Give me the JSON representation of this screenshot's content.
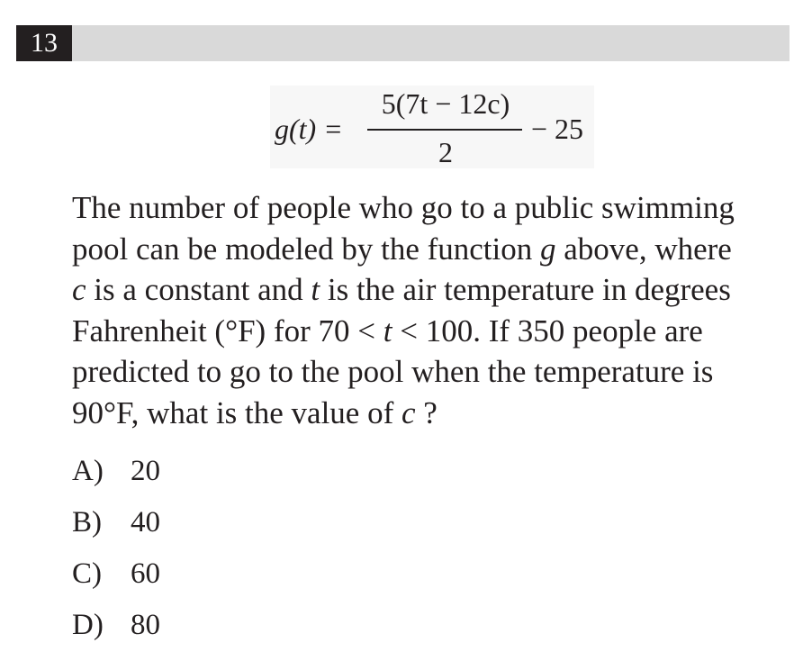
{
  "question_number": "13",
  "formula": {
    "lhs": "g(t) =",
    "numerator": "5(7t − 12c)",
    "denominator": "2",
    "rhs": "− 25"
  },
  "question_text": {
    "line1": "The number of people who go to a public swimming",
    "line2_a": "pool can be modeled by the function ",
    "line2_var": "g",
    "line2_b": " above, where",
    "line3_var_c": "c",
    "line3_a": " is a constant and ",
    "line3_var_t": "t",
    "line3_b": " is the air temperature in degrees",
    "line4_a": "Fahrenheit (°F) for 70 < ",
    "line4_var": "t",
    "line4_b": " < 100. If 350 people are",
    "line5": "predicted to go to the pool when the temperature is",
    "line6_a": "90°F, what is the value of ",
    "line6_var": "c",
    "line6_b": " ?"
  },
  "choices": [
    {
      "letter": "A)",
      "value": "20"
    },
    {
      "letter": "B)",
      "value": "40"
    },
    {
      "letter": "C)",
      "value": "60"
    },
    {
      "letter": "D)",
      "value": "80"
    }
  ]
}
